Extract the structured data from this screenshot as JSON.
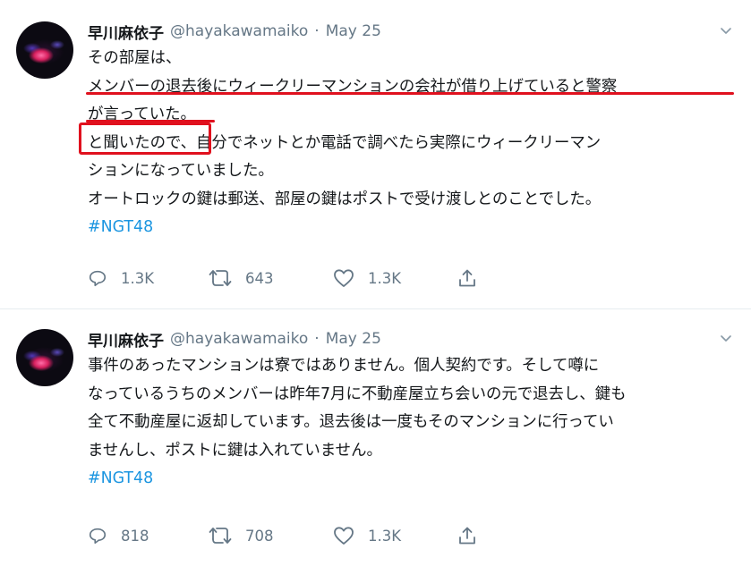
{
  "tweets": [
    {
      "name": "早川麻依子",
      "handle": "@hayakawamaiko",
      "separator": "·",
      "date": "May 25",
      "lines": [
        "その部屋は、",
        "メンバーの退去後にウィークリーマンションの会社が借り上げていると警察",
        "が言っていた。",
        "と聞いたので、自分でネットとか電話で調べたら実際にウィークリーマン",
        "ションになっていました。",
        "オートロックの鍵は郵送、部屋の鍵はポストで受け渡しとのことでした。"
      ],
      "hashtag": "#NGT48",
      "replies": "1.3K",
      "retweets": "643",
      "likes": "1.3K"
    },
    {
      "name": "早川麻依子",
      "handle": "@hayakawamaiko",
      "separator": "·",
      "date": "May 25",
      "lines": [
        "事件のあったマンションは寮ではありません。個人契約です。そして噂に",
        "なっているうちのメンバーは昨年7月に不動産屋立ち会いの元で退去し、鍵も",
        "全て不動産屋に返却しています。退去後は一度もそのマンションに行ってい",
        "ませんし、ポストに鍵は入れていません。"
      ],
      "hashtag": "#NGT48",
      "replies": "818",
      "retweets": "708",
      "likes": "1.3K"
    }
  ],
  "icons": {
    "caret": "chevron-down-icon",
    "reply": "reply-icon",
    "retweet": "retweet-icon",
    "like": "heart-icon",
    "share": "share-icon"
  },
  "colors": {
    "hashtag": "#1b95e0",
    "muted": "#657786",
    "annotation": "#e0111e"
  }
}
